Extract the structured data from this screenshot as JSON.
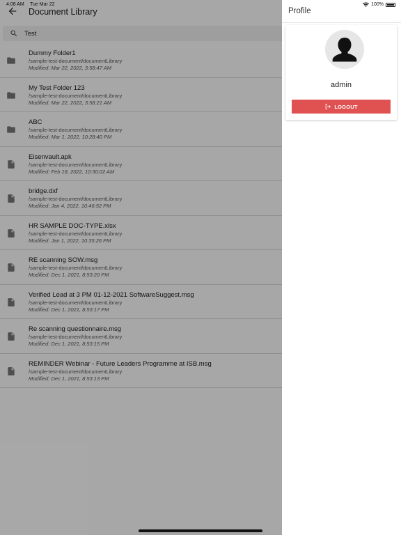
{
  "status_bar": {
    "time": "4:08 AM",
    "date": "Tue Mar 22",
    "battery": "100%"
  },
  "header": {
    "title": "Document Library"
  },
  "search": {
    "value": "Test"
  },
  "items": [
    {
      "name": "Dummy Folder1",
      "path": "/sample-test-document/documentLibrary",
      "modified": "Modified: Mar 22, 2022, 3:58:47 AM",
      "icon": "folder-icon"
    },
    {
      "name": "My Test Folder 123",
      "path": "/sample-test-document/documentLibrary",
      "modified": "Modified: Mar 22, 2022, 3:58:21 AM",
      "icon": "folder-icon"
    },
    {
      "name": "ABC",
      "path": "/sample-test-document/documentLibrary",
      "modified": "Modified: Mar 1, 2022, 10:28:40 PM",
      "icon": "folder-icon"
    },
    {
      "name": "Eisenvault.apk",
      "path": "/sample-test-document/documentLibrary",
      "modified": "Modified: Feb 18, 2022, 10:30:02 AM",
      "icon": "file-icon"
    },
    {
      "name": "bridge.dxf",
      "path": "/sample-test-document/documentLibrary",
      "modified": "Modified: Jan 4, 2022, 10:46:52 PM",
      "icon": "file-icon"
    },
    {
      "name": "HR SAMPLE DOC-TYPE.xlsx",
      "path": "/sample-test-document/documentLibrary",
      "modified": "Modified: Jan 1, 2022, 10:35:26 PM",
      "icon": "file-icon"
    },
    {
      "name": "RE scanning SOW.msg",
      "path": "/sample-test-document/documentLibrary",
      "modified": "Modified: Dec 1, 2021, 8:53:20 PM",
      "icon": "file-icon"
    },
    {
      "name": "Verified Lead at 3 PM 01-12-2021 SoftwareSuggest.msg",
      "path": "/sample-test-document/documentLibrary",
      "modified": "Modified: Dec 1, 2021, 8:53:17 PM",
      "icon": "file-icon"
    },
    {
      "name": "Re scanning questionnaire.msg",
      "path": "/sample-test-document/documentLibrary",
      "modified": "Modified: Dec 1, 2021, 8:53:15 PM",
      "icon": "file-icon"
    },
    {
      "name": "REMINDER Webinar - Future Leaders Programme at ISB.msg",
      "path": "/sample-test-document/documentLibrary",
      "modified": "Modified: Dec 1, 2021, 8:53:13 PM",
      "icon": "file-icon"
    }
  ],
  "drawer": {
    "title": "Profile",
    "username": "admin",
    "logout_label": "LOGOUT"
  },
  "colors": {
    "logout_button": "#e05252",
    "overlay": "#000000",
    "icon_gray": "#757575"
  }
}
